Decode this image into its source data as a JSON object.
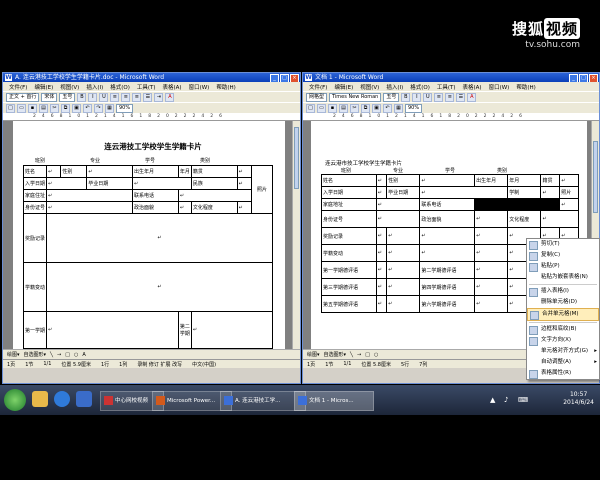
{
  "watermark": {
    "brand_a": "搜狐",
    "brand_b": "视频",
    "url": "tv.sohu.com"
  },
  "left_window": {
    "title": "A. 连云港技工学校学生学籍卡片.doc - Microsoft Word",
    "menu": [
      "文件(F)",
      "编辑(E)",
      "视图(V)",
      "插入(I)",
      "格式(O)",
      "工具(T)",
      "表格(A)",
      "窗口(W)",
      "帮助(H)"
    ],
    "style_box": "正文 + 首行",
    "font_box": "宋体",
    "size_box": "五号",
    "zoom": "90%",
    "heading": "连云港技工学校学生学籍卡片",
    "header_fields": [
      "班别",
      "专业",
      "学号",
      "类别"
    ],
    "rows": [
      [
        "姓名",
        "性别",
        "出生年月",
        "年月",
        "籍贯"
      ],
      [
        "入学日期",
        "毕业日期",
        "民族"
      ],
      [
        "家庭住址",
        "联系电话"
      ],
      [
        "身份证号",
        "政治面貌",
        "文化程度"
      ]
    ],
    "photo_label": "照片",
    "big_rows": [
      "奖励记录",
      "学籍变动",
      "第一学期",
      "第二学期"
    ],
    "status": [
      "1页",
      "1节",
      "1/1",
      "位置 5.9厘米",
      "1行",
      "1列"
    ],
    "status_right": "录制 修订 扩展 改写",
    "status_lang": "中文(中国)"
  },
  "right_window": {
    "title": "文档 1 - Microsoft Word",
    "menu": [
      "文件(F)",
      "编辑(E)",
      "视图(V)",
      "插入(I)",
      "格式(O)",
      "工具(T)",
      "表格(A)",
      "窗口(W)",
      "帮助(H)"
    ],
    "style_box": "网格型",
    "font_box": "Times New Roman",
    "size_box": "五号",
    "zoom": "90%",
    "heading": "连云港市技工学校学生学籍卡片",
    "header_fields": [
      "班别",
      "专业",
      "学号",
      "类别"
    ],
    "rows": [
      [
        "姓名",
        "性别",
        "出生年月",
        "年月",
        "籍贯"
      ],
      [
        "入学日期",
        "毕业日期",
        "学制",
        "照片"
      ],
      [
        "家庭地址",
        "联系电话"
      ],
      [
        "身份证号",
        "政治面貌",
        "文化程度"
      ],
      [
        "奖励记录"
      ],
      [
        "学籍变动"
      ],
      [
        "第一学期德评语",
        "第二学期德评语"
      ],
      [
        "第三学期德评语",
        "第四学期德评语"
      ],
      [
        "第五学期德评语",
        "第六学期德评语"
      ]
    ],
    "status": [
      "1页",
      "1节",
      "1/1",
      "位置 5.8厘米",
      "5行",
      "7列"
    ]
  },
  "context_menu": {
    "items": [
      {
        "label": "剪切(T)",
        "disabled": false
      },
      {
        "label": "复制(C)",
        "disabled": false
      },
      {
        "label": "粘贴(P)",
        "disabled": false
      },
      {
        "label": "粘贴为嵌套表格(N)",
        "disabled": false
      },
      {
        "label": "插入表格(I)",
        "disabled": false
      },
      {
        "label": "删除单元格(D)",
        "disabled": false
      },
      {
        "label": "合并单元格(M)",
        "disabled": false,
        "highlight": true
      },
      {
        "label": "边框和底纹(B)",
        "disabled": false
      },
      {
        "label": "文字方向(X)",
        "disabled": false
      },
      {
        "label": "单元格对齐方式(G)",
        "disabled": false
      },
      {
        "label": "自动调整(A)",
        "disabled": false
      },
      {
        "label": "表格属性(R)",
        "disabled": false
      }
    ]
  },
  "taskbar": {
    "tasks": [
      "中心网校视频",
      "Microsoft Power...",
      "A. 连云港技工学...",
      "文档 1 - Micros..."
    ],
    "time": "10:57",
    "date": "2014/6/24"
  },
  "colors": {
    "title_blue": "#0a3fb8",
    "menu_bg": "#ece9d8",
    "doc_bg": "#808080",
    "highlight": "#ffeebb"
  }
}
